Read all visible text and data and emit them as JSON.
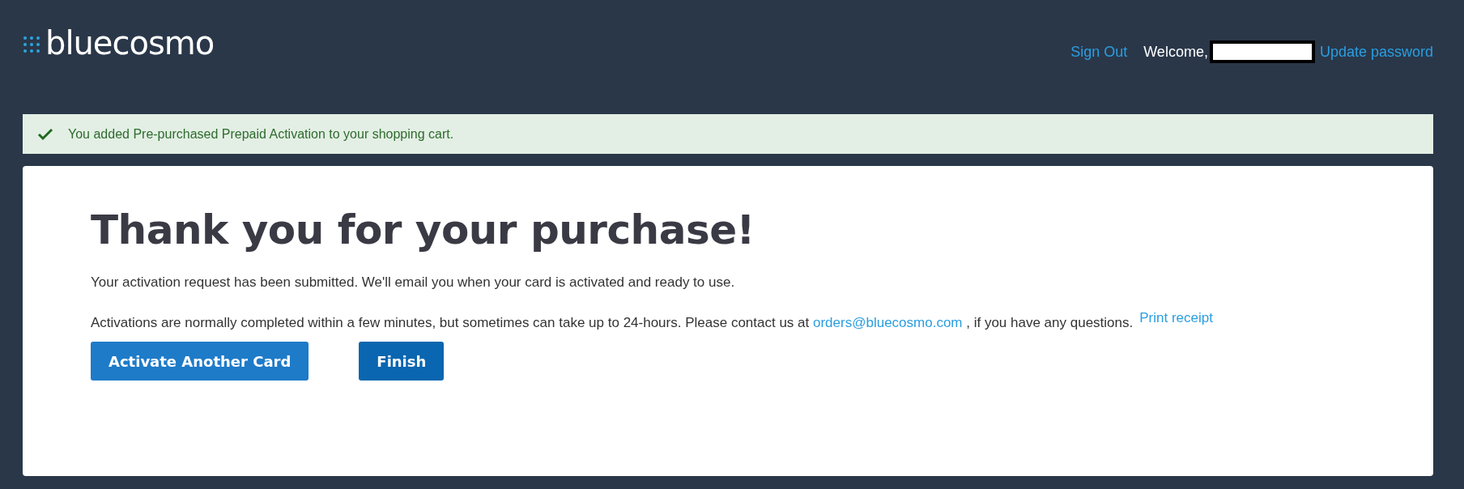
{
  "header": {
    "logo": "bluecosmo",
    "links": [
      {
        "kind": "link",
        "label": "Sign Out"
      },
      {
        "kind": "welcome",
        "label": "Welcome,"
      },
      {
        "kind": "redacted"
      },
      {
        "kind": "link",
        "label": "Update password"
      }
    ]
  },
  "notice": {
    "kind": "success",
    "message": "You added Pre-purchased Prepaid Activation to your shopping cart."
  },
  "main": {
    "heading": "Thank you for your purchase!",
    "paragraph_1": "Your activation request has been submitted. We'll email you when your card is activated and ready to use.",
    "paragraph_2": {
      "before": "Activations are normally completed within a few minutes, but sometimes can take up to 24-hours. Please contact us at ",
      "email": "orders@bluecosmo.com",
      "after": " , if you have any questions."
    },
    "print_link": "Print receipt",
    "buttons": [
      {
        "label": "Activate Another Card",
        "kind": "secondary"
      },
      {
        "label": "Finish",
        "kind": "primary"
      }
    ]
  }
}
